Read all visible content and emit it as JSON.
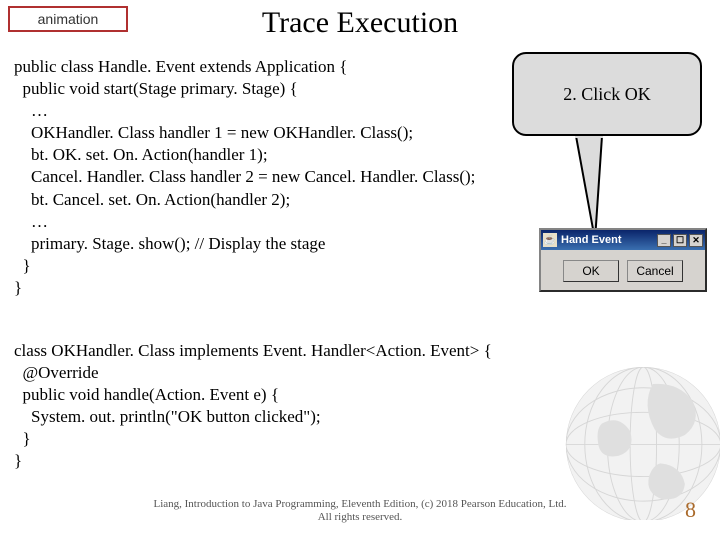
{
  "animation_label": "animation",
  "title": "Trace Execution",
  "code1": "public class Handle. Event extends Application {\n  public void start(Stage primary. Stage) {\n    …\n    OKHandler. Class handler 1 = new OKHandler. Class();\n    bt. OK. set. On. Action(handler 1);\n    Cancel. Handler. Class handler 2 = new Cancel. Handler. Class();\n    bt. Cancel. set. On. Action(handler 2);\n    …\n    primary. Stage. show(); // Display the stage\n  }\n}",
  "code2": "class OKHandler. Class implements Event. Handler<Action. Event> {\n  @Override\n  public void handle(Action. Event e) {\n    System. out. println(\"OK button clicked\");\n  }\n}",
  "callout_text": "2. Click OK",
  "window": {
    "title": "Hand   Event",
    "min": "_",
    "max": "☐",
    "close": "✕",
    "ok": "OK",
    "cancel": "Cancel"
  },
  "footer_line1": "Liang, Introduction to Java Programming, Eleventh Edition, (c) 2018 Pearson Education, Ltd.",
  "footer_line2": "All rights reserved.",
  "page_number": "8"
}
